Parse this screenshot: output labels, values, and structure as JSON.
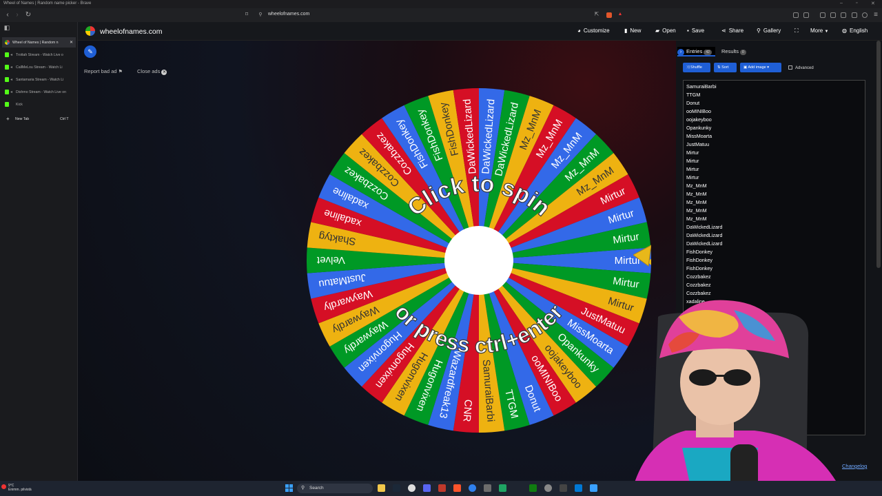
{
  "window": {
    "title": "Wheel of Names | Random name picker - Brave"
  },
  "browser": {
    "url": "wheelofnames.com"
  },
  "tabs": [
    {
      "title": "Wheel of Names | Random n",
      "active": true
    },
    {
      "title": "Trottah Stream - Watch Live o"
    },
    {
      "title": "CallMeLou Stream - Watch Li"
    },
    {
      "title": "Santamaria Stream - Watch Li"
    },
    {
      "title": "Dishmo Stream - Watch Live on"
    },
    {
      "title": "Kick"
    }
  ],
  "new_tab": {
    "label": "New Tab",
    "shortcut": "Ctrl T"
  },
  "header": {
    "site_name": "wheelofnames.com",
    "menu": [
      {
        "label": "Customize",
        "icon": "palette-icon"
      },
      {
        "label": "New",
        "icon": "file-icon"
      },
      {
        "label": "Open",
        "icon": "folder-icon"
      },
      {
        "label": "Save",
        "icon": "save-icon"
      },
      {
        "label": "Share",
        "icon": "share-icon"
      },
      {
        "label": "Gallery",
        "icon": "search-icon"
      },
      {
        "label": "",
        "icon": "fullscreen-icon"
      },
      {
        "label": "More",
        "icon": "chevron-down-icon"
      },
      {
        "label": "English",
        "icon": "globe-icon"
      }
    ]
  },
  "main": {
    "report_ad": "Report bad ad",
    "close_ads": "Close ads"
  },
  "wheel": {
    "text_top": "Click to spin",
    "text_bottom": "or press ctrl+enter",
    "colors": [
      "#3369e8",
      "#009925",
      "#eeb211",
      "#d50f25"
    ],
    "slices": [
      "Mirtur",
      "Mirtur",
      "Mirtur",
      "JustMatuu",
      "MissMoarta",
      "Opankunky",
      "oojakeyboo",
      "ooMINIBoo",
      "Donut",
      "TTGM",
      "SamuraiBarbi",
      "CNR",
      "Wazardfreak13",
      "Hugonvixen",
      "Hugonvixen",
      "Hugonvixen",
      "Hugonvixen",
      "Waywardly",
      "Waywardly",
      "Waywardly",
      "JustMatuu",
      "Velvet",
      "Shaktyg",
      "xadaline",
      "xadaline",
      "Cozzbakez",
      "Cozzbakez",
      "Cozzbakez",
      "FishDonkey",
      "FishDonkey",
      "FishDonkey",
      "DaWickedLizard",
      "DaWickedLizard",
      "DaWickedLizard",
      "Mz_MnM",
      "Mz_MnM",
      "Mz_MnM",
      "Mz_MnM",
      "Mz_MnM",
      "Mirtur",
      "Mirtur",
      "Mirtur"
    ]
  },
  "panel": {
    "entries_label": "Entries",
    "entries_count": "42",
    "results_label": "Results",
    "results_count": "0",
    "shuffle": "Shuffle",
    "sort": "Sort",
    "add_image": "Add image",
    "advanced": "Advanced",
    "entries": [
      "SamuraiBarbi",
      "TTGM",
      "Donut",
      "ooMINIBoo",
      "oojakeyboo",
      "Opankunky",
      "MissMoarta",
      "JustMatuu",
      "Mirtur",
      "Mirtur",
      "Mirtur",
      "Mirtur",
      "Mz_MnM",
      "Mz_MnM",
      "Mz_MnM",
      "Mz_MnM",
      "Mz_MnM",
      "DaWickedLizard",
      "DaWickedLizard",
      "DaWickedLizard",
      "FishDonkey",
      "FishDonkey",
      "FishDonkey",
      "Cozzbakez",
      "Cozzbakez",
      "Cozzbakez",
      "xadaline"
    ],
    "changelog": "Changelog"
  },
  "taskbar": {
    "temp": "9°C",
    "weather": "Enimm. pilvistä",
    "search": "Search"
  }
}
